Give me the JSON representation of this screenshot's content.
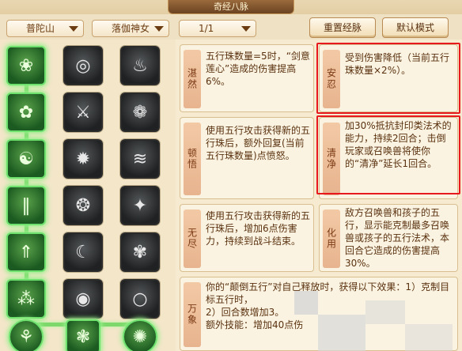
{
  "window": {
    "title": "奇经八脉"
  },
  "toolbar": {
    "faction": "普陀山",
    "role": "落伽神女",
    "page": "1/1",
    "reset_label": "重置经脉",
    "default_label": "默认模式"
  },
  "grid": {
    "rows": [
      [
        {
          "icon": "lotus-icon",
          "glyph": "❀",
          "active": true
        },
        {
          "icon": "swirl-icon",
          "glyph": "◎",
          "active": false
        },
        {
          "icon": "flame-icon",
          "glyph": "♨",
          "active": false
        }
      ],
      [
        {
          "icon": "lotus-seat-icon",
          "glyph": "✿",
          "active": true
        },
        {
          "icon": "sword-icon",
          "glyph": "⚔",
          "active": false
        },
        {
          "icon": "lotus-flower-icon",
          "glyph": "❁",
          "active": false
        }
      ],
      [
        {
          "icon": "wave-icon",
          "glyph": "☯",
          "active": true
        },
        {
          "icon": "vortex-icon",
          "glyph": "✹",
          "active": false
        },
        {
          "icon": "wind-icon",
          "glyph": "≋",
          "active": false
        }
      ],
      [
        {
          "icon": "bamboo-icon",
          "glyph": "‖",
          "active": true
        },
        {
          "icon": "spiral-icon",
          "glyph": "❂",
          "active": false
        },
        {
          "icon": "beast-icon",
          "glyph": "✦",
          "active": false
        }
      ],
      [
        {
          "icon": "up-arrow-icon",
          "glyph": "⇑",
          "active": true
        },
        {
          "icon": "crescent-icon",
          "glyph": "☾",
          "active": false
        },
        {
          "icon": "bloom-icon",
          "glyph": "✾",
          "active": false
        }
      ],
      [
        {
          "icon": "orbs-icon",
          "glyph": "⁂",
          "active": true
        },
        {
          "icon": "ring-icon",
          "glyph": "◉",
          "active": false
        },
        {
          "icon": "circle-icon",
          "glyph": "○",
          "active": false
        }
      ],
      [
        {
          "icon": "gourd-icon",
          "glyph": "⚘",
          "active": true
        },
        {
          "icon": "flower-bed-icon",
          "glyph": "❃",
          "active": true
        },
        {
          "icon": "spirit-icon",
          "glyph": "✺",
          "active": true
        }
      ]
    ]
  },
  "skills": [
    {
      "name": "湛然",
      "desc": "五行珠数量=5时，“剑意莲心”造成的伤害提高6%。"
    },
    {
      "name": "顿悟",
      "desc": "使用五行攻击获得新的五行珠后，额外回复(当前五行珠数量)点愤怒。"
    },
    {
      "name": "无尽",
      "desc": "使用五行攻击获得新的五行珠后，增加6点伤害力，持续到战斗结束。"
    },
    {
      "name": "万象",
      "desc": "你的“颠倒五行”对自己释放时，获得以下效果：1）克制目标五行时，"
    },
    {
      "name": "安忍",
      "desc": "受到伤害降低（当前五行珠数量×2%）。"
    },
    {
      "name": "清净",
      "desc": "加30%抵抗封印类法术的能力，持续2回合；击倒玩家或召唤兽将使你的“清净”延长1回合。"
    },
    {
      "name": "化用",
      "desc": "敌方召唤兽和孩子的五行，显示能克制最多召唤兽或孩子的五行法术，本回合它造成的伤害提高30%。"
    }
  ],
  "wanxiang_extra": {
    "line2": "2）回合数增加3。",
    "line3": "额外技能：增加40点伤"
  }
}
